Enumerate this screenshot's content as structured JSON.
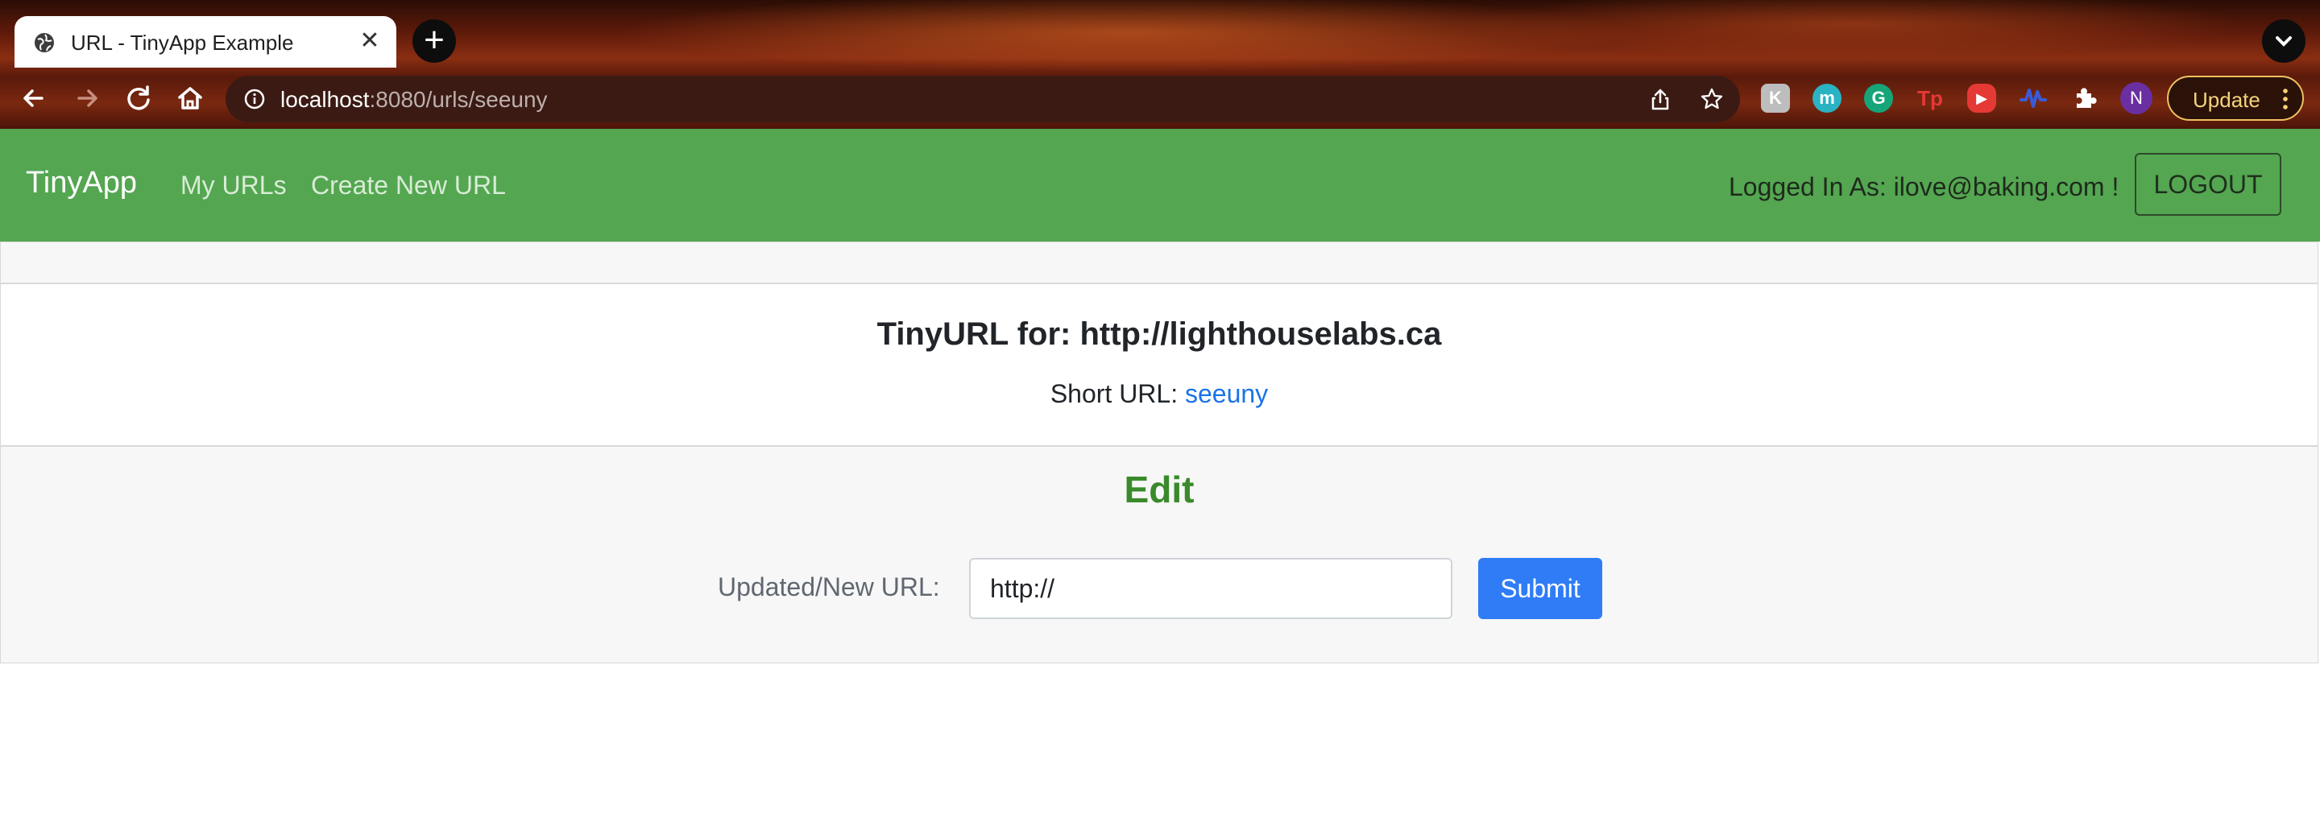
{
  "browser": {
    "tab_title": "URL - TinyApp Example",
    "close_glyph": "✕",
    "new_tab_glyph": "+",
    "url_host": "localhost",
    "url_path": ":8080/urls/seeuny",
    "update_label": "Update",
    "profile_initial": "N",
    "icons": [
      "back-icon",
      "forward-icon",
      "reload-icon",
      "home-icon",
      "site-info-icon",
      "share-icon",
      "bookmark-star-icon",
      "extensions-puzzle-icon"
    ],
    "extensions": [
      {
        "name": "extension-k-icon",
        "glyph": "K",
        "color": "#bdbdbd"
      },
      {
        "name": "extension-m-icon",
        "glyph": "m",
        "color": "#2ab3c2"
      },
      {
        "name": "grammarly-icon",
        "glyph": "G",
        "color": "#15a579"
      },
      {
        "name": "extension-tp-icon",
        "glyph": "Tp",
        "color": "#e53935"
      },
      {
        "name": "extension-video-icon",
        "glyph": "▶",
        "color": "#e53935"
      },
      {
        "name": "extension-wave-icon",
        "glyph": "〰",
        "color": "#3a5bd9"
      }
    ],
    "accent_update": "#f6d37a"
  },
  "navbar": {
    "brand": "TinyApp",
    "links": [
      "My URLs",
      "Create New URL"
    ],
    "logged_in_text": "Logged In As: ilove@baking.com !",
    "logout_label": "LOGOUT",
    "color": "#54a651"
  },
  "card": {
    "title": "TinyURL for: http://lighthouselabs.ca",
    "short_url_label": "Short URL:",
    "short_url_value": "seeuny",
    "edit_heading": "Edit",
    "form_label": "Updated/New URL:",
    "input_value": "http://",
    "submit_label": "Submit",
    "submit_color": "#2f7cf6",
    "edit_color": "#3a8a2c"
  }
}
